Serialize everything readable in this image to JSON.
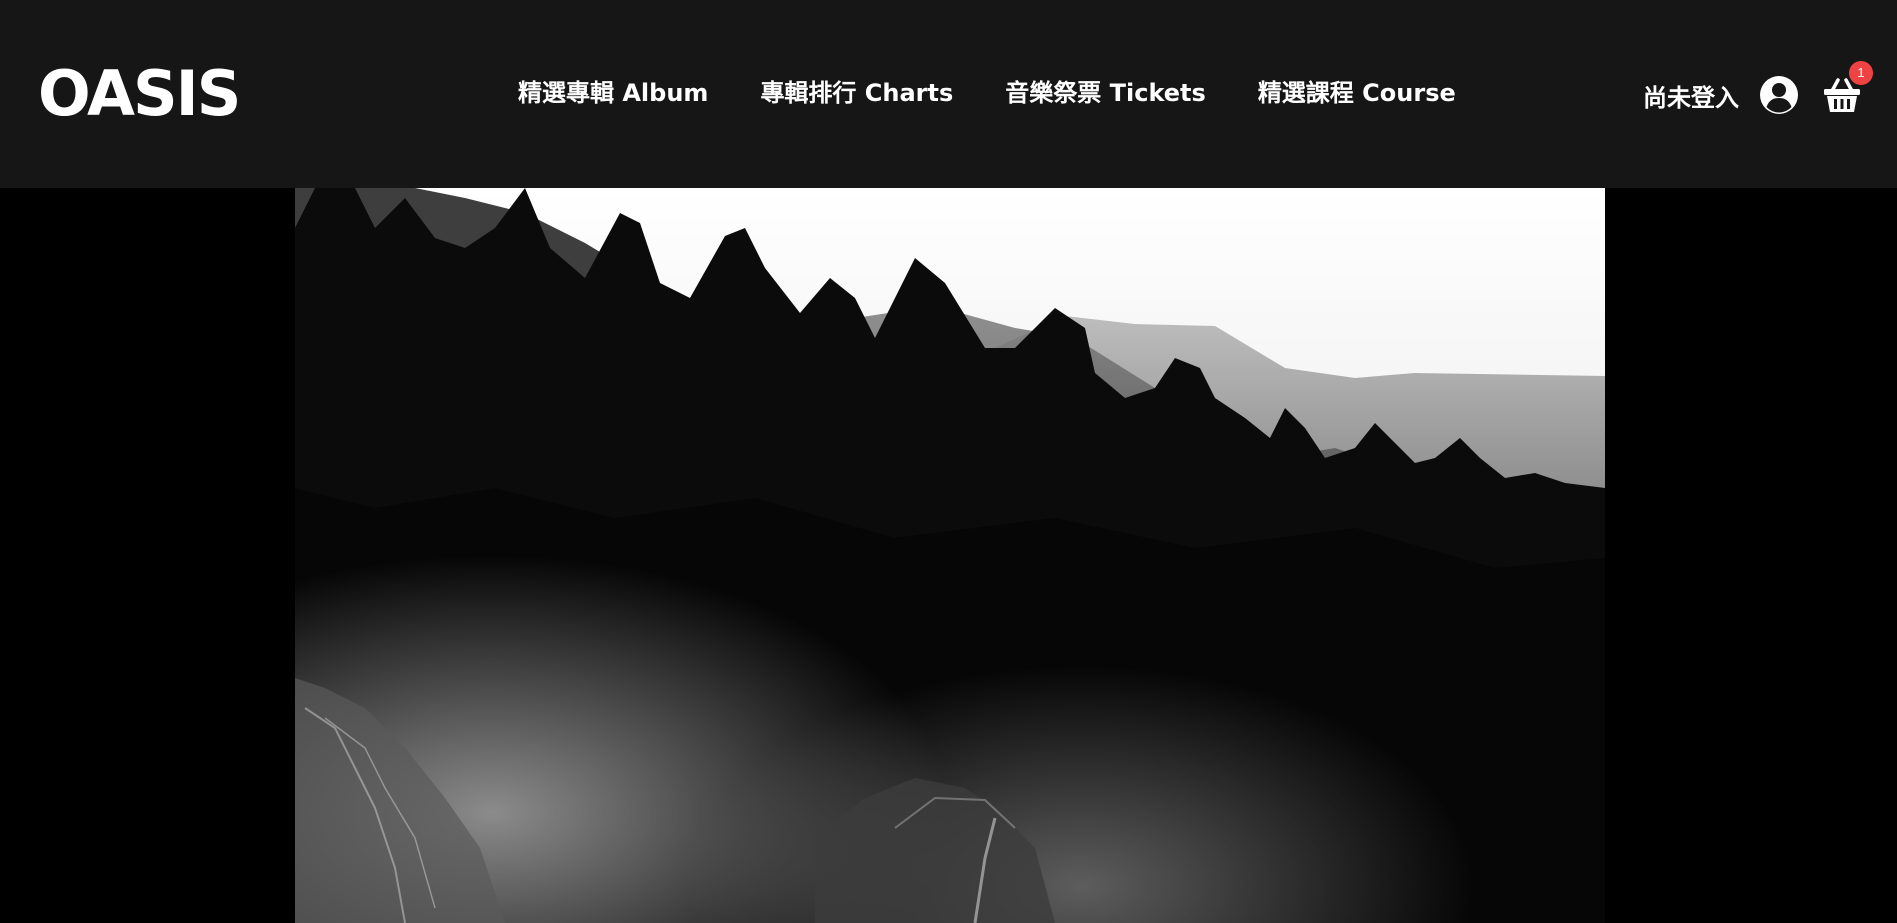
{
  "header": {
    "logo": "OASIS",
    "nav": [
      {
        "label": "精選專輯 Album"
      },
      {
        "label": "專輯排行 Charts"
      },
      {
        "label": "音樂祭票 Tickets"
      },
      {
        "label": "精選課程 Course"
      }
    ],
    "login_status": "尚未登入",
    "user_icon": "user-circle-icon",
    "cart_icon": "shopping-basket-icon",
    "cart_count": "1"
  },
  "hero": {
    "media": "video",
    "scene": "black-and-white forest"
  },
  "colors": {
    "header_bg": "#161616",
    "page_bg": "#000000",
    "badge": "#ef4343",
    "text": "#ffffff"
  }
}
